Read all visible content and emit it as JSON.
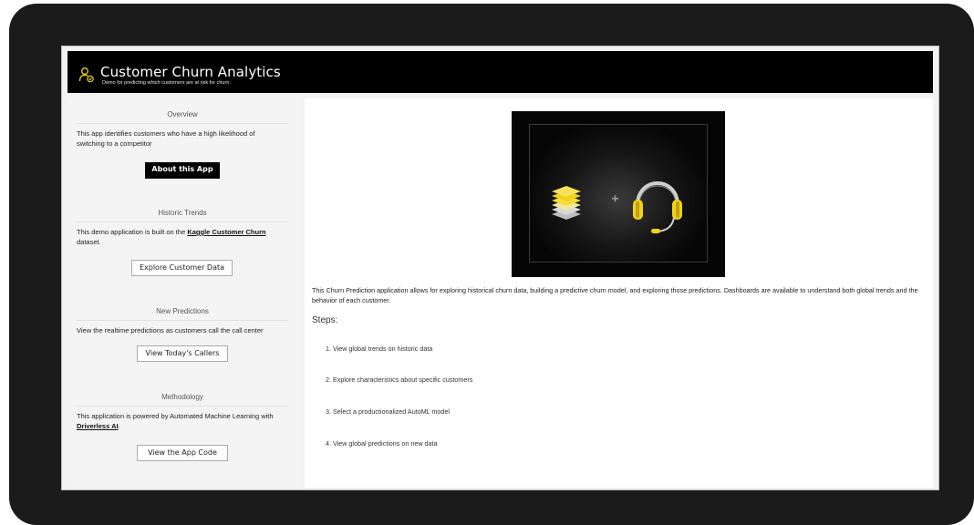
{
  "app": {
    "title": "Customer Churn Analytics",
    "subtitle": "Demo for predicting which customers are at risk for churn."
  },
  "sidebar": {
    "overview": {
      "title": "Overview",
      "text": "This app identifies customers who have a high likelihood of switching to a competitor",
      "button": "About this App"
    },
    "historic": {
      "title": "Historic Trends",
      "text_before": "This demo application is built on the ",
      "link": "Kaggle Customer Churn",
      "text_after": " dataset.",
      "button": "Explore Customer Data"
    },
    "predictions": {
      "title": "New Predictions",
      "text": "View the realtime predictions as customers call the call center",
      "button": "View Today's Callers"
    },
    "methodology": {
      "title": "Methodology",
      "text_before": "This application is powered by Automated Machine Learning with ",
      "link": "Driverless AI",
      "text_after": ".",
      "button": "View the App Code"
    }
  },
  "main": {
    "description": "This Churn Prediction application allows for exploring historical churn data, building a predictive churn model, and exploring those predictions. Dashboards are available to understand both global trends and the behavior of each customer.",
    "steps_title": "Steps:",
    "steps": [
      "1.  View global trends on historic data",
      "2.  Explore characteristics about specific customers",
      "3.  Select a productionalized AutoML model",
      "4.  View global predictions on new data"
    ]
  },
  "colors": {
    "header_bg": "#000000",
    "accent_yellow": "#f2d21b",
    "bezel": "#1b1b1b"
  }
}
